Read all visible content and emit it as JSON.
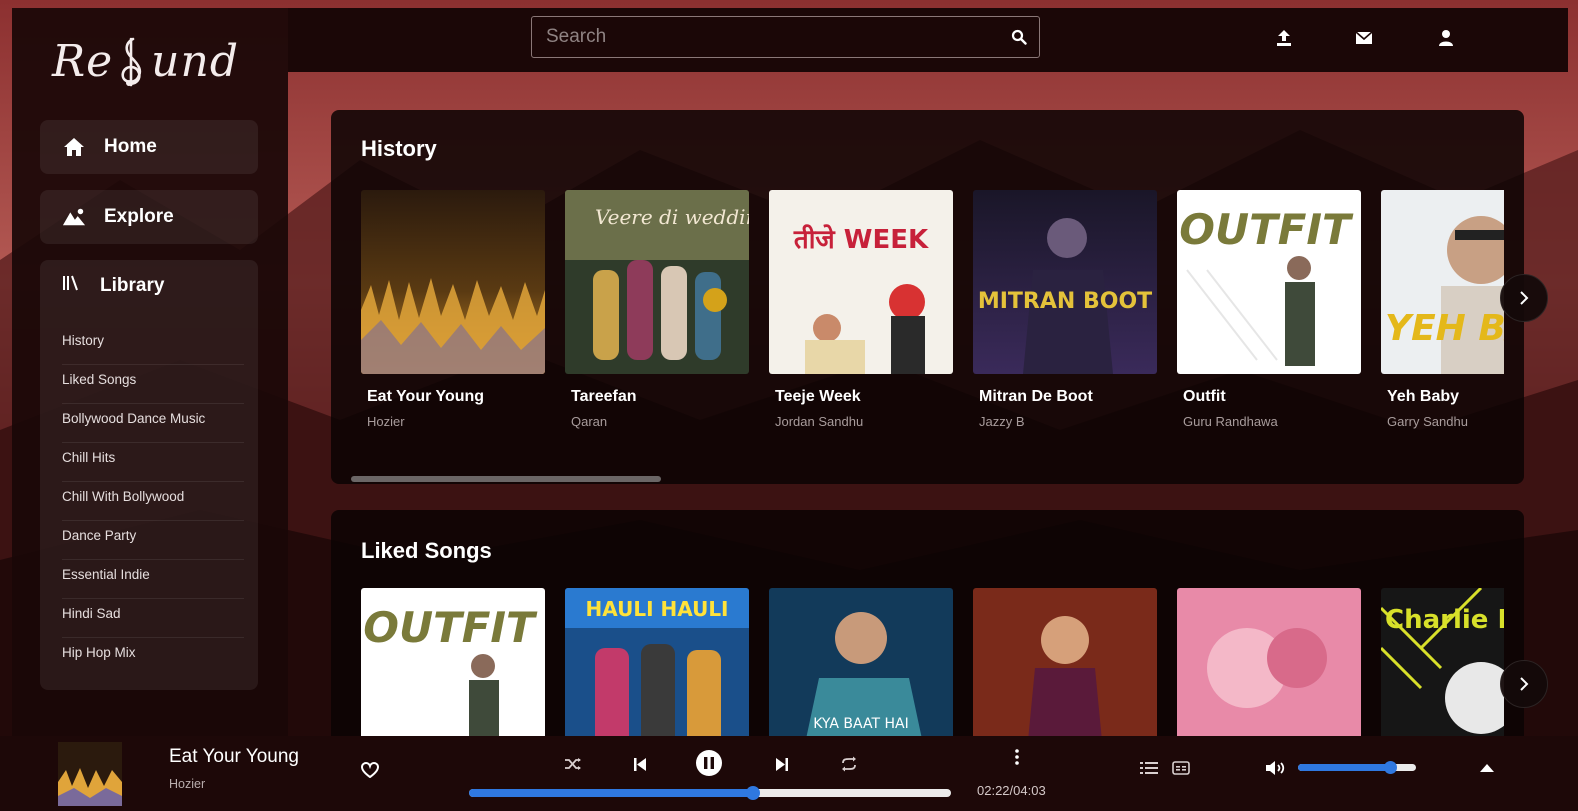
{
  "brand": {
    "logo_prefix": "Re",
    "logo_suffix": "und"
  },
  "nav": {
    "home_label": "Home",
    "explore_label": "Explore"
  },
  "library": {
    "label": "Library",
    "items": [
      "History",
      "Liked Songs",
      "Bollywood Dance Music",
      "Chill Hits",
      "Chill With Bollywood",
      "Dance Party",
      "Essential Indie",
      "Hindi Sad",
      "Hip Hop Mix"
    ]
  },
  "search": {
    "placeholder": "Search"
  },
  "header": {
    "icons": [
      "upload-icon",
      "mail-icon",
      "user-icon"
    ]
  },
  "sections": [
    {
      "title": "History",
      "cards": [
        {
          "title": "Eat Your Young",
          "artist": "Hozier",
          "cover_text": ""
        },
        {
          "title": "Tareefan",
          "artist": "Qaran",
          "cover_text": "Veere di wedding"
        },
        {
          "title": "Teeje Week",
          "artist": "Jordan Sandhu",
          "cover_text": "तीजे WEEK"
        },
        {
          "title": "Mitran De Boot",
          "artist": "Jazzy B",
          "cover_text": "MITRAN BOOT"
        },
        {
          "title": "Outfit",
          "artist": "Guru Randhawa",
          "cover_text": "OUTFIT"
        },
        {
          "title": "Yeh Baby",
          "artist": "Garry Sandhu",
          "cover_text": "YEH BA"
        }
      ]
    },
    {
      "title": "Liked Songs",
      "cards": [
        {
          "title": "",
          "artist": "",
          "cover_text": "OUTFIT"
        },
        {
          "title": "",
          "artist": "",
          "cover_text": "HAULI HAULI"
        },
        {
          "title": "",
          "artist": "",
          "cover_text": "KYA BAAT HAI"
        },
        {
          "title": "",
          "artist": "",
          "cover_text": ""
        },
        {
          "title": "",
          "artist": "",
          "cover_text": ""
        },
        {
          "title": "",
          "artist": "",
          "cover_text": "Charlie P"
        }
      ]
    }
  ],
  "player": {
    "title": "Eat Your Young",
    "artist": "Hozier",
    "time": "02:22/04:03",
    "progress": 0.59,
    "volume": 0.78,
    "state": "playing"
  },
  "colors": {
    "accent": "#2f78e0",
    "background": "#140707",
    "sidebar": "#1a0808"
  }
}
